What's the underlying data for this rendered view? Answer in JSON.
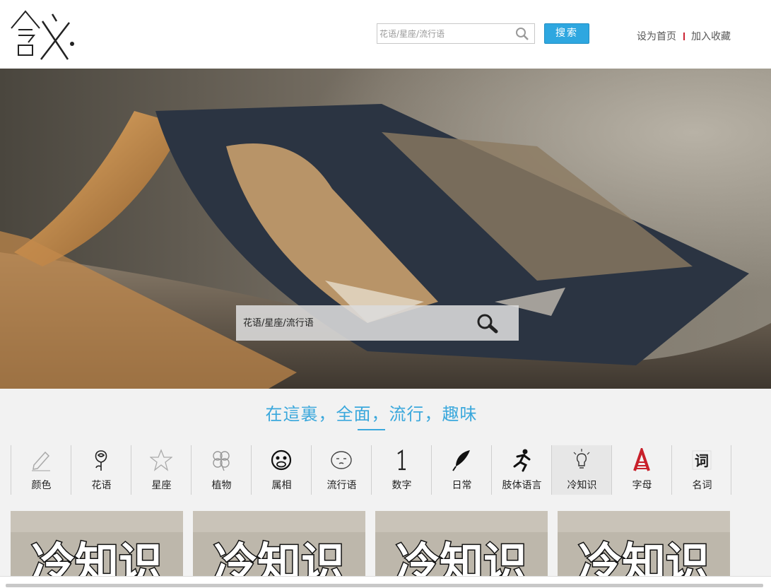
{
  "header": {
    "logo_text": "含义",
    "search_placeholder": "花语/星座/流行语",
    "search_button": "搜索",
    "links": [
      "设为首页",
      "加入收藏"
    ]
  },
  "hero": {
    "search_placeholder": "花语/星座/流行语"
  },
  "tagline": "在這裏，全面，流行，趣味",
  "categories": [
    {
      "label": "颜色",
      "icon": "pencil-icon"
    },
    {
      "label": "花语",
      "icon": "rose-icon"
    },
    {
      "label": "星座",
      "icon": "star-icon"
    },
    {
      "label": "植物",
      "icon": "clover-icon"
    },
    {
      "label": "属相",
      "icon": "monkey-icon"
    },
    {
      "label": "流行语",
      "icon": "face-bubble-icon"
    },
    {
      "label": "数字",
      "icon": "number-one-icon"
    },
    {
      "label": "日常",
      "icon": "feather-icon"
    },
    {
      "label": "肢体语言",
      "icon": "running-figure-icon"
    },
    {
      "label": "冷知识",
      "icon": "lightbulb-icon"
    },
    {
      "label": "字母",
      "icon": "letter-a-icon"
    },
    {
      "label": "名词",
      "icon": "word-icon"
    }
  ],
  "active_category_index": 9,
  "cards": [
    {
      "title": "冷知识"
    },
    {
      "title": "冷知识"
    },
    {
      "title": "冷知识"
    },
    {
      "title": "冷知识"
    }
  ],
  "colors": {
    "accent": "#2ea7e0",
    "tagline": "#3ba8dc",
    "link_separator": "#cc2233"
  }
}
